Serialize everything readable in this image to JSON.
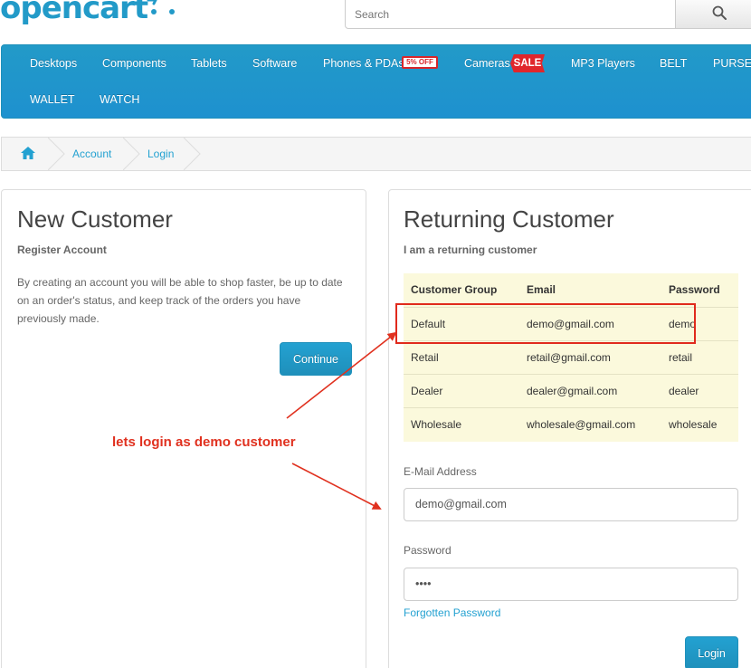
{
  "header": {
    "logo_text": "opencart",
    "search": {
      "placeholder": "Search"
    }
  },
  "menu": {
    "items": [
      {
        "label": "Desktops"
      },
      {
        "label": "Components"
      },
      {
        "label": "Tablets"
      },
      {
        "label": "Software"
      },
      {
        "label": "Phones & PDAs",
        "badge": "5% OFF"
      },
      {
        "label": "Cameras",
        "badge": "SALE"
      },
      {
        "label": "MP3 Players"
      },
      {
        "label": "BELT"
      },
      {
        "label": "PURSE"
      },
      {
        "label": "WALLET"
      },
      {
        "label": "WATCH"
      }
    ]
  },
  "breadcrumb": {
    "items": [
      {
        "label": "Account"
      },
      {
        "label": "Login"
      }
    ]
  },
  "new_customer": {
    "title": "New Customer",
    "subtitle": "Register Account",
    "text": "By creating an account you will be able to shop faster, be up to date on an order's status, and keep track of the orders you have previously made.",
    "button": "Continue"
  },
  "returning_customer": {
    "title": "Returning Customer",
    "subtitle": "I am a returning customer",
    "table": {
      "headers": [
        "Customer Group",
        "Email",
        "Password"
      ],
      "rows": [
        [
          "Default",
          "demo@gmail.com",
          "demo"
        ],
        [
          "Retail",
          "retail@gmail.com",
          "retail"
        ],
        [
          "Dealer",
          "dealer@gmail.com",
          "dealer"
        ],
        [
          "Wholesale",
          "wholesale@gmail.com",
          "wholesale"
        ]
      ]
    },
    "email_label": "E-Mail Address",
    "email_value": "demo@gmail.com",
    "password_label": "Password",
    "password_value": "••••",
    "forgotten_link": "Forgotten Password",
    "button": "Login"
  },
  "annotation": {
    "text": "lets login as demo customer",
    "color": "#e0311f"
  },
  "colors": {
    "brand": "#229ac8",
    "link": "#23a1d1",
    "annotation": "#e0311f"
  }
}
